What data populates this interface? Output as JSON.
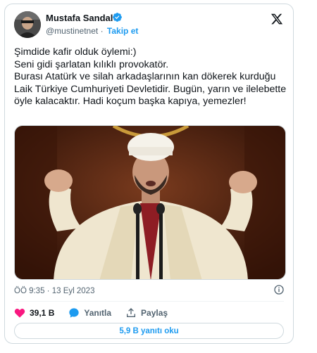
{
  "author": {
    "name": "Mustafa Sandal",
    "handle": "@mustinetnet",
    "separator": "·",
    "follow_label": "Takip et",
    "verified_icon": "verified-badge-icon"
  },
  "brand_icon": "x-logo-icon",
  "tweet": {
    "text": "Şimdide kafir olduk öylemi:)\nSeni gidi şarlatan kılıklı provokatör.\nBurası Atatürk ve silah arkadaşlarının kan dökerek kurduğu Laik Türkiye Cumhuriyeti Devletidir. Bugün, yarın ve ilelebette öyle kalacaktır. Hadi koçum başka kapıya, yemezler!"
  },
  "meta": {
    "time": "ÖÖ 9:35",
    "separator": "·",
    "date": "13 Eyl 2023"
  },
  "actions": {
    "like_count": "39,1 B",
    "reply_label": "Yanıtla",
    "share_label": "Paylaş"
  },
  "read_replies_label": "5,9 B yanıtı oku",
  "colors": {
    "accent": "#1d9bf0",
    "like": "#f91880",
    "text": "#0f1419",
    "muted": "#536471"
  }
}
